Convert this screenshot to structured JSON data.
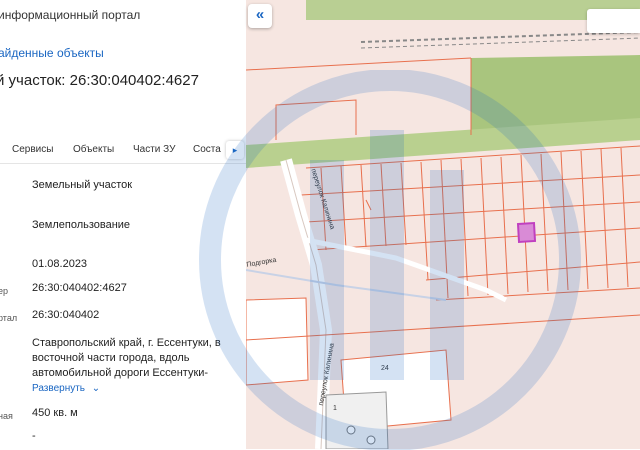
{
  "header": {
    "portal_title": "информационный портал",
    "found_link": "айденные объекты",
    "parcel_title": "й участок: 26:30:040402:4627"
  },
  "tabs": [
    {
      "label": "Сервисы"
    },
    {
      "label": "Объекты"
    },
    {
      "label": "Части ЗУ"
    },
    {
      "label": "Соста"
    }
  ],
  "tab_more_icon": "chevron-right-icon",
  "rows": [
    {
      "label": "",
      "value": "Земельный участок"
    },
    {
      "label": "",
      "value": "Землепользование"
    },
    {
      "label": "",
      "value": "01.08.2023"
    },
    {
      "label": "ер",
      "value": "26:30:040402:4627"
    },
    {
      "label": "ртал",
      "value": "26:30:040402"
    },
    {
      "label": "ная",
      "value": "450 кв. м"
    },
    {
      "label": "",
      "value": "-"
    }
  ],
  "address_lines": [
    "Ставропольский край, г. Ессентуки, в",
    "восточной части города, вдоль",
    "автомобильной дороги Ессентуки-"
  ],
  "expand_label": "Развернуть",
  "map": {
    "collapse_icon": "double-chevron-left-icon",
    "street_labels": [
      "переулок Калинина",
      "переулок Калинина",
      "Подгорка"
    ],
    "house_labels": [
      "24",
      "1"
    ],
    "colors": {
      "background": "#f6e6e1",
      "green": "#a9c57e",
      "parcel_line": "#e8704e",
      "highlight": "#c040c0",
      "road": "#ffffff",
      "accent": "#1a66c2"
    }
  }
}
